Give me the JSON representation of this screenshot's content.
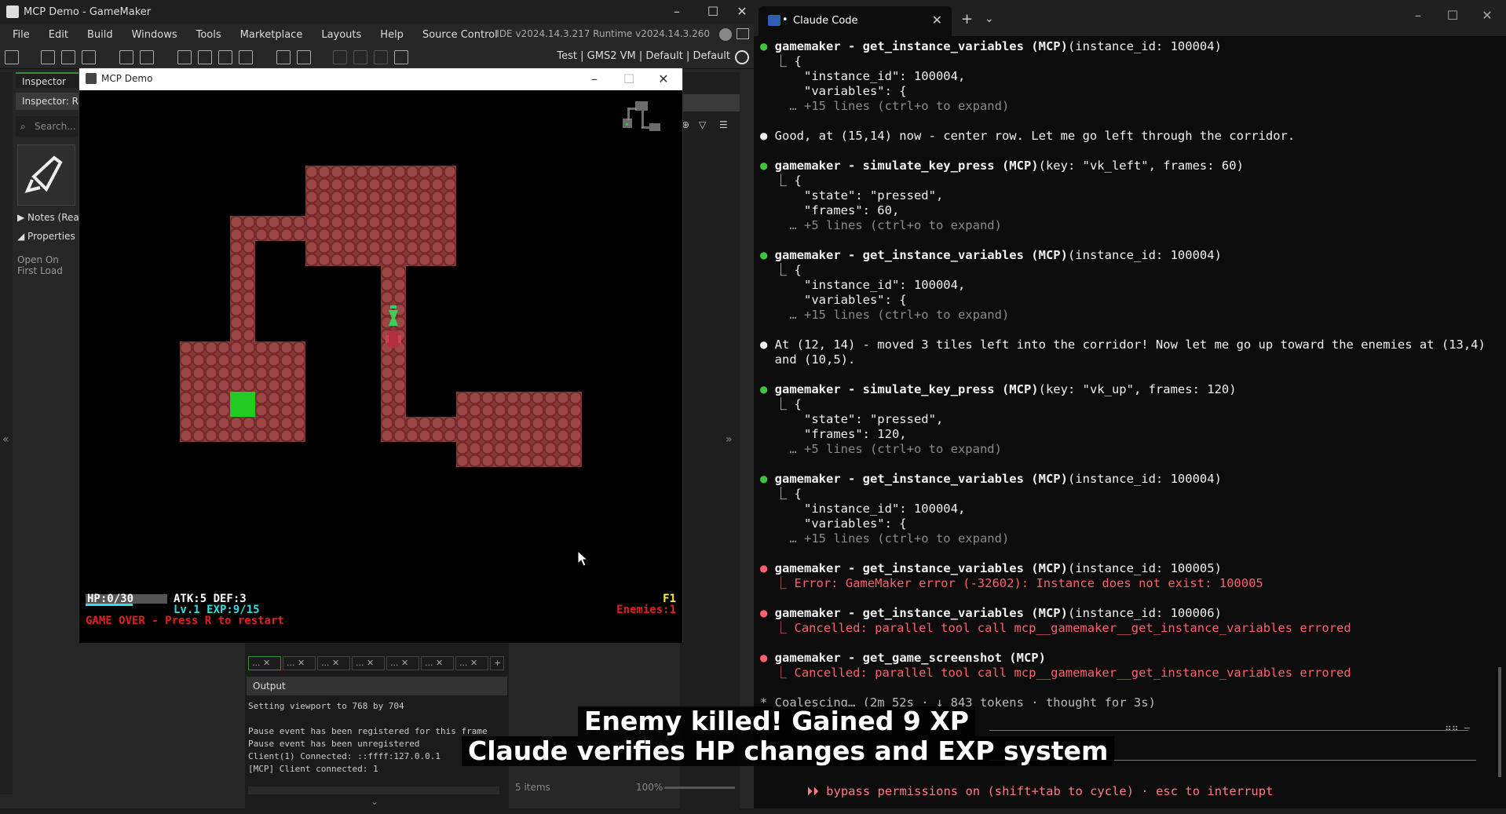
{
  "gamemaker": {
    "title": "MCP Demo - GameMaker",
    "menu": [
      "File",
      "Edit",
      "Build",
      "Windows",
      "Tools",
      "Marketplace",
      "Layouts",
      "Help",
      "Source Control"
    ],
    "version": "IDE v2024.14.3.217  Runtime v2024.14.3.260",
    "target": "Test  |  GMS2 VM  |  Default  |  Default",
    "inspector": {
      "tab": "Inspector",
      "subtab": "Inspector: Re",
      "search_placeholder": "Search...",
      "notes": "Notes (Rea",
      "properties": "Properties",
      "open_on_first_load": "Open On First Load"
    },
    "output": {
      "header": "Output",
      "lines": [
        "Setting viewport to 768 by 704",
        "",
        "Pause event has been registered for this frame",
        "Pause event has been unregistered",
        "Client(1) Connected: ::ffff:127.0.0.1",
        "[MCP] Client connected: 1"
      ],
      "items": "5 items",
      "zoom": "100%"
    }
  },
  "game": {
    "title": "MCP Demo",
    "hud": {
      "hp": "HP:0/30",
      "hp_fraction": 0,
      "atk_def": "ATK:5 DEF:3",
      "level_exp": "Lv.1 EXP:9/15",
      "game_over": "GAME OVER - Press R to restart",
      "floor": "F1",
      "enemies": "Enemies:1"
    }
  },
  "claude": {
    "tab_title": "Claude Code",
    "lines": [
      {
        "t": "● gamemaker - get_instance_variables (MCP)(instance_id: 100004)",
        "c": "tool-g"
      },
      {
        "t": "  ⎿ {",
        "c": "w"
      },
      {
        "t": "      \"instance_id\": 100004,",
        "c": "w"
      },
      {
        "t": "      \"variables\": {",
        "c": "w"
      },
      {
        "t": "    … +15 lines (ctrl+o to expand)",
        "c": "dim"
      },
      {
        "t": "",
        "c": "w"
      },
      {
        "t": "● Good, at (15,14) now - center row. Let me go left through the corridor.",
        "c": "msg"
      },
      {
        "t": "",
        "c": "w"
      },
      {
        "t": "● gamemaker - simulate_key_press (MCP)(key: \"vk_left\", frames: 60)",
        "c": "tool-g"
      },
      {
        "t": "  ⎿ {",
        "c": "w"
      },
      {
        "t": "      \"state\": \"pressed\",",
        "c": "w"
      },
      {
        "t": "      \"frames\": 60,",
        "c": "w"
      },
      {
        "t": "    … +5 lines (ctrl+o to expand)",
        "c": "dim"
      },
      {
        "t": "",
        "c": "w"
      },
      {
        "t": "● gamemaker - get_instance_variables (MCP)(instance_id: 100004)",
        "c": "tool-g"
      },
      {
        "t": "  ⎿ {",
        "c": "w"
      },
      {
        "t": "      \"instance_id\": 100004,",
        "c": "w"
      },
      {
        "t": "      \"variables\": {",
        "c": "w"
      },
      {
        "t": "    … +15 lines (ctrl+o to expand)",
        "c": "dim"
      },
      {
        "t": "",
        "c": "w"
      },
      {
        "t": "● At (12, 14) - moved 3 tiles left into the corridor! Now let me go up toward the enemies at (13,4)",
        "c": "msg"
      },
      {
        "t": "  and (10,5).",
        "c": "w"
      },
      {
        "t": "",
        "c": "w"
      },
      {
        "t": "● gamemaker - simulate_key_press (MCP)(key: \"vk_up\", frames: 120)",
        "c": "tool-g"
      },
      {
        "t": "  ⎿ {",
        "c": "w"
      },
      {
        "t": "      \"state\": \"pressed\",",
        "c": "w"
      },
      {
        "t": "      \"frames\": 120,",
        "c": "w"
      },
      {
        "t": "    … +5 lines (ctrl+o to expand)",
        "c": "dim"
      },
      {
        "t": "",
        "c": "w"
      },
      {
        "t": "● gamemaker - get_instance_variables (MCP)(instance_id: 100004)",
        "c": "tool-g"
      },
      {
        "t": "  ⎿ {",
        "c": "w"
      },
      {
        "t": "      \"instance_id\": 100004,",
        "c": "w"
      },
      {
        "t": "      \"variables\": {",
        "c": "w"
      },
      {
        "t": "    … +15 lines (ctrl+o to expand)",
        "c": "dim"
      },
      {
        "t": "",
        "c": "w"
      },
      {
        "t": "● gamemaker - get_instance_variables (MCP)(instance_id: 100005)",
        "c": "tool-r"
      },
      {
        "t": "  ⎿ Error: GameMaker error (-32602): Instance does not exist: 100005",
        "c": "err"
      },
      {
        "t": "",
        "c": "w"
      },
      {
        "t": "● gamemaker - get_instance_variables (MCP)(instance_id: 100006)",
        "c": "tool-r"
      },
      {
        "t": "  ⎿ Cancelled: parallel tool call mcp__gamemaker__get_instance_variables errored",
        "c": "err"
      },
      {
        "t": "",
        "c": "w"
      },
      {
        "t": "● gamemaker - get_game_screenshot (MCP)",
        "c": "tool-r"
      },
      {
        "t": "  ⎿ Cancelled: parallel tool call mcp__gamemaker__get_instance_variables errored",
        "c": "err"
      },
      {
        "t": "",
        "c": "w"
      },
      {
        "t": "* Coalescing… (2m 52s · ↓ 843 tokens · thought for 3s)",
        "c": "status"
      }
    ],
    "prompt_footer": "⏵⏵ bypass permissions on (shift+tab to cycle) · esc to interrupt"
  },
  "captions": {
    "line1": "Enemy killed! Gained 9 XP",
    "line2": "Claude verifies HP changes and EXP system"
  },
  "colors": {
    "tool_ok": "#3fc43f",
    "tool_err": "#ff5f6d",
    "tile": "#8b3a3a",
    "player": "#22cc22"
  }
}
